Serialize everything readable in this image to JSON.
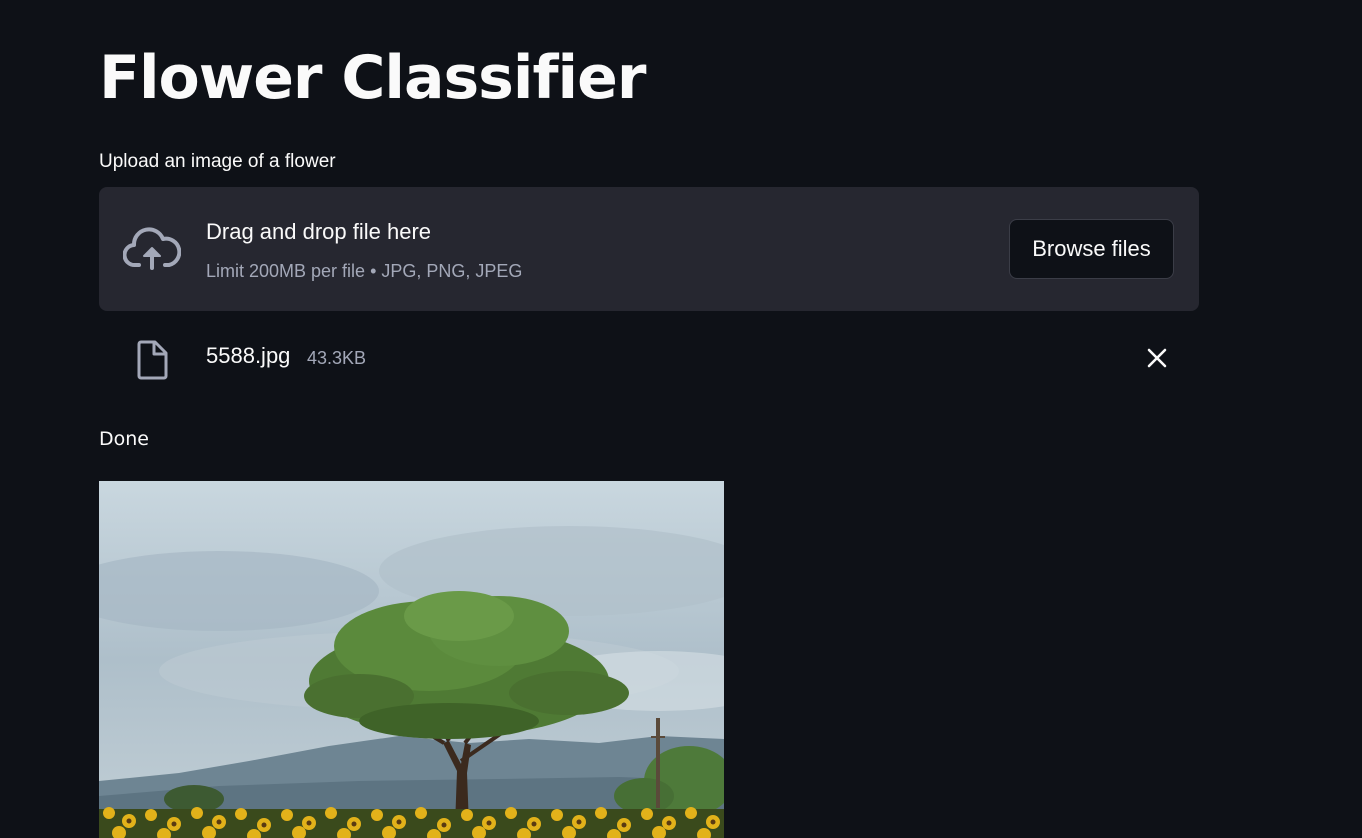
{
  "page": {
    "title": "Flower Classifier"
  },
  "uploader": {
    "label": "Upload an image of a flower",
    "dropzone_title": "Drag and drop file here",
    "dropzone_subtitle": "Limit 200MB per file • JPG, PNG, JPEG",
    "browse_button_label": "Browse files",
    "upload_icon": "cloud-upload-icon"
  },
  "uploaded_file": {
    "name": "5588.jpg",
    "size": "43.3KB",
    "file_icon": "file-icon",
    "remove_icon": "close-icon"
  },
  "status": {
    "text": "Done"
  },
  "colors": {
    "background": "#0e1117",
    "dropzone": "#262730",
    "text": "#fafafa",
    "muted_text": "#a3a8b8"
  }
}
